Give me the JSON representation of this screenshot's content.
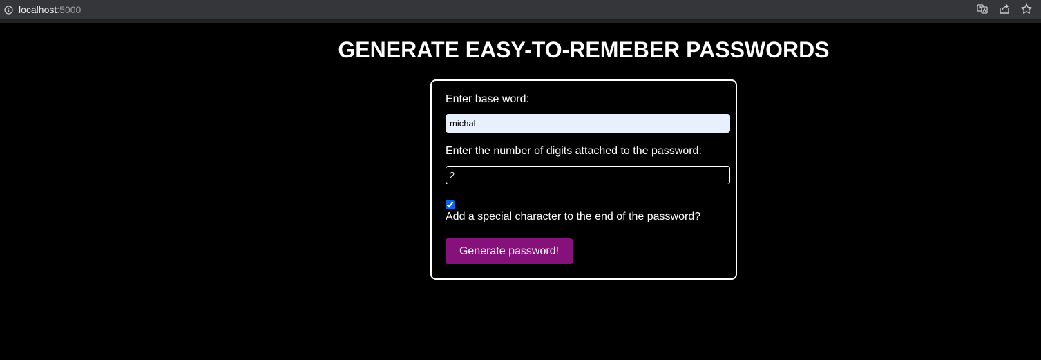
{
  "browser": {
    "url_host": "localhost",
    "url_port": ":5000",
    "icons": [
      "info-icon",
      "translate-icon",
      "share-icon",
      "bookmark-star-icon"
    ]
  },
  "page": {
    "title": "GENERATE EASY-TO-REMEBER PASSWORDS"
  },
  "form": {
    "base_word_label": "Enter base word:",
    "base_word_value": "michal",
    "digits_label": "Enter the number of digits attached to the password:",
    "digits_value": "2",
    "special_char_checked": true,
    "special_char_label": "Add a special character to the end of the password?",
    "submit_label": "Generate password!"
  },
  "colors": {
    "background": "#000000",
    "button": "#87117b",
    "autofill_input": "#e8f0fe",
    "checkbox_accent": "#0b63e5"
  }
}
